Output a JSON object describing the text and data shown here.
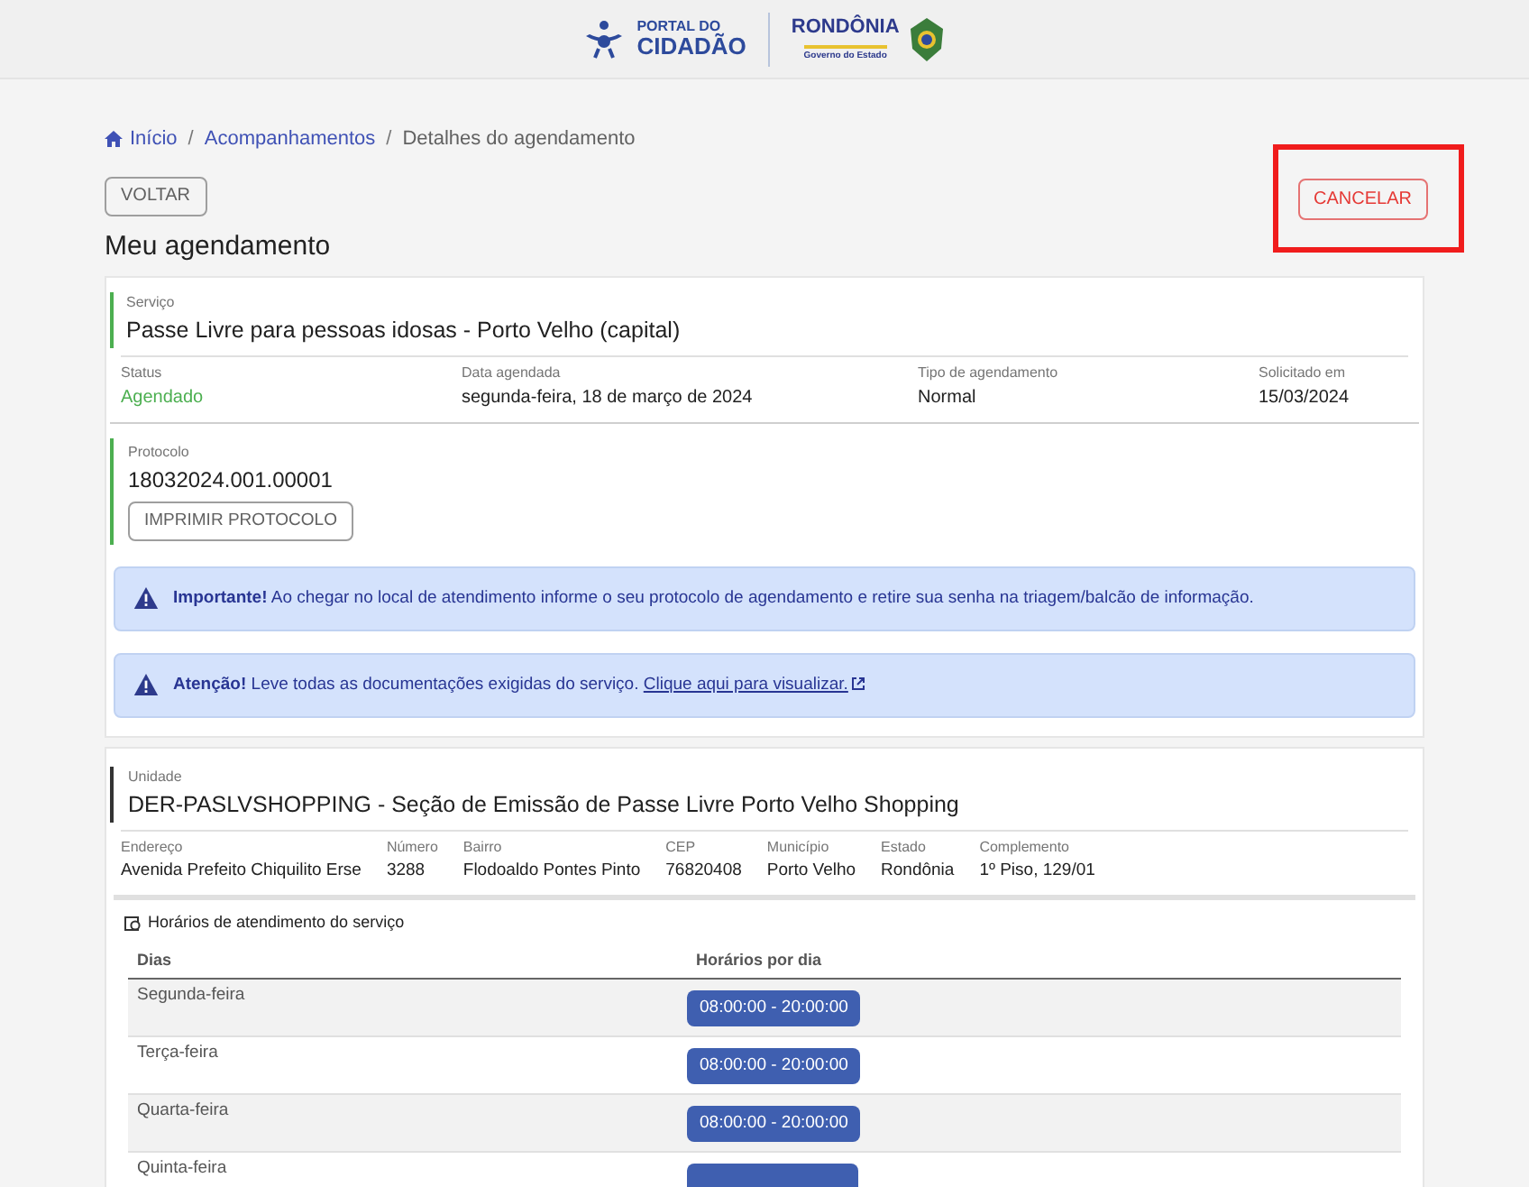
{
  "header": {
    "portal_logo": [
      "PORTAL DO",
      "CIDADÃO"
    ],
    "state_logo": {
      "name": "RONDÔNIA",
      "subtitle": "Governo do Estado"
    }
  },
  "breadcrumb": [
    {
      "label": "Início",
      "kind": "home"
    },
    {
      "label": "Acompanhamentos",
      "kind": "link",
      "separator_before": "/"
    },
    {
      "label": "Detalhes do agendamento",
      "kind": "current",
      "separator_before": "/"
    }
  ],
  "back_button": "VOLTAR",
  "cancel_button": {
    "label": "CANCELAR",
    "highlighted": true
  },
  "title": "Meu agendamento",
  "appointment": {
    "service": {
      "label": "Serviço",
      "value": "Passe Livre para pessoas idosas - Porto Velho (capital)"
    },
    "details": [
      {
        "label": "Status",
        "value": "Agendado",
        "kind": "status"
      },
      {
        "label": "Data agendada",
        "value": "segunda-feira, 18 de março de 2024",
        "kind": "text"
      },
      {
        "label": "Tipo de agendamento",
        "value": "Normal",
        "kind": "text"
      },
      {
        "label": "Solicitado em",
        "value": "15/03/2024",
        "kind": "text"
      }
    ],
    "protocol": {
      "label": "Protocolo",
      "value": "18032024.001.00001",
      "button": "IMPRIMIR PROTOCOLO"
    },
    "alerts": [
      {
        "text": "**Importante!** Ao chegar no local de atendimento informe o seu protocolo de agendamento e retire sua senha na triagem/balcão de informação."
      },
      {
        "text": "**Atenção!** Leve todas as documentações exigidas do serviço.",
        "link": "Clique aqui para visualizar."
      }
    ]
  },
  "unit": {
    "label": "Unidade",
    "value": "DER-PASLVSHOPPING - Seção de Emissão de Passe Livre Porto Velho Shopping",
    "details": [
      {
        "label": "Endereço",
        "value": "Avenida Prefeito Chiquilito Erse"
      },
      {
        "label": "Número",
        "value": "3288"
      },
      {
        "label": "Bairro",
        "value": "Flodoaldo Pontes Pinto"
      },
      {
        "label": "CEP",
        "value": "76820408"
      },
      {
        "label": "Município",
        "value": "Porto Velho"
      },
      {
        "label": "Estado",
        "value": "Rondônia"
      },
      {
        "label": "Complemento",
        "value": "1º Piso, 129/01"
      }
    ],
    "hours_title": "Horários de atendimento do serviço",
    "columns": [
      "Dias",
      "Horários por dia"
    ],
    "rows": [
      {
        "day": "Segunda-feira",
        "hours": "08:00:00 - 20:00:00"
      },
      {
        "day": "Terça-feira",
        "hours": "08:00:00 - 20:00:00"
      },
      {
        "day": "Quarta-feira",
        "hours": "08:00:00 - 20:00:00"
      },
      {
        "day": "Quinta-feira"
      }
    ]
  }
}
